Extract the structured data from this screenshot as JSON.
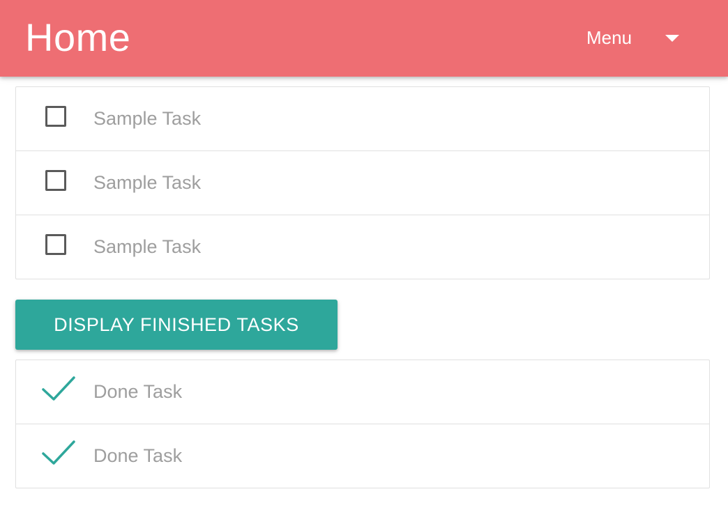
{
  "header": {
    "title": "Home",
    "menu_label": "Menu",
    "menu_icon": "chevron-down-icon",
    "background_color": "#ee6e73"
  },
  "pending_tasks": [
    {
      "label": "Sample Task",
      "checked": false
    },
    {
      "label": "Sample Task",
      "checked": false
    },
    {
      "label": "Sample Task",
      "checked": false
    }
  ],
  "toggle_button": {
    "label": "DISPLAY FINISHED TASKS",
    "color": "#2ea79b"
  },
  "finished_tasks": [
    {
      "label": "Done Task",
      "icon": "checkmark-icon"
    },
    {
      "label": "Done Task",
      "icon": "checkmark-icon"
    }
  ],
  "colors": {
    "accent": "#2ea79b",
    "muted_text": "#9e9e9e",
    "divider": "#e0e0e0"
  }
}
